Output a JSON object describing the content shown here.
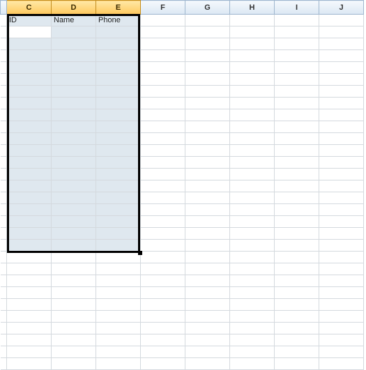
{
  "columns": {
    "c": "C",
    "d": "D",
    "e": "E",
    "f": "F",
    "g": "G",
    "h": "H",
    "i": "I",
    "j": "J"
  },
  "headers": {
    "c": "ID",
    "d": "Name",
    "e": "Phone"
  },
  "selection": {
    "selected_columns": [
      "C",
      "D",
      "E"
    ],
    "active_cell": "C2"
  }
}
